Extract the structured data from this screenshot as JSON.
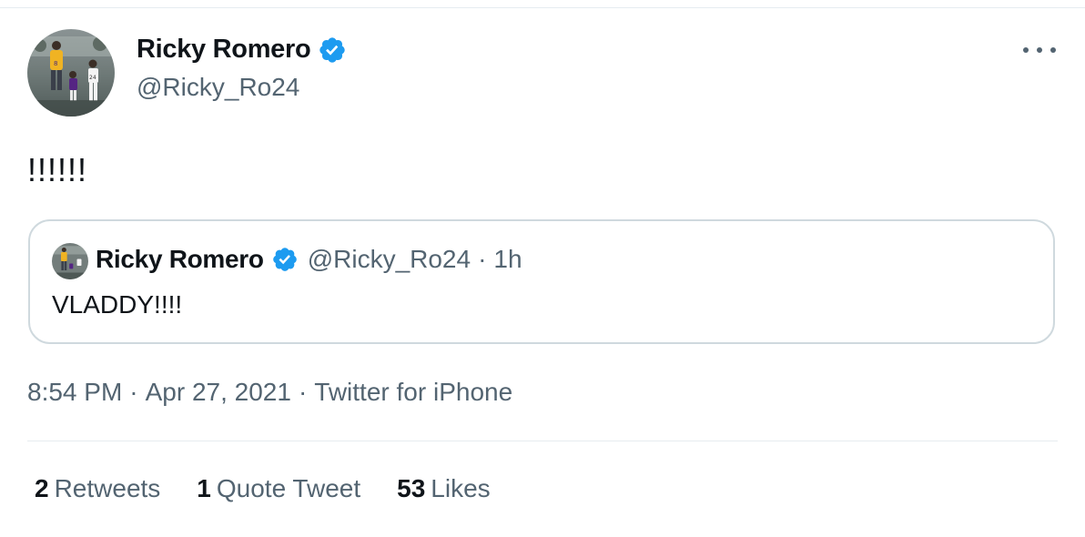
{
  "tweet": {
    "author": {
      "name": "Ricky Romero",
      "handle": "@Ricky_Ro24",
      "avatar_icon": "avatar-photo-icon"
    },
    "text": "!!!!!!",
    "quoted": {
      "name": "Ricky Romero",
      "handle": "@Ricky_Ro24",
      "separator": "·",
      "time": "1h",
      "text": "VLADDY!!!!"
    },
    "meta": {
      "time": "8:54 PM",
      "separator": "·",
      "date": "Apr 27, 2021",
      "source": "Twitter for iPhone"
    },
    "stats": [
      {
        "count": "2",
        "label": "Retweets"
      },
      {
        "count": "1",
        "label": "Quote Tweet"
      },
      {
        "count": "53",
        "label": "Likes"
      }
    ]
  },
  "colors": {
    "verified_blue": "#1d9bf0",
    "secondary_text": "#536471",
    "border": "#cfd9de"
  }
}
